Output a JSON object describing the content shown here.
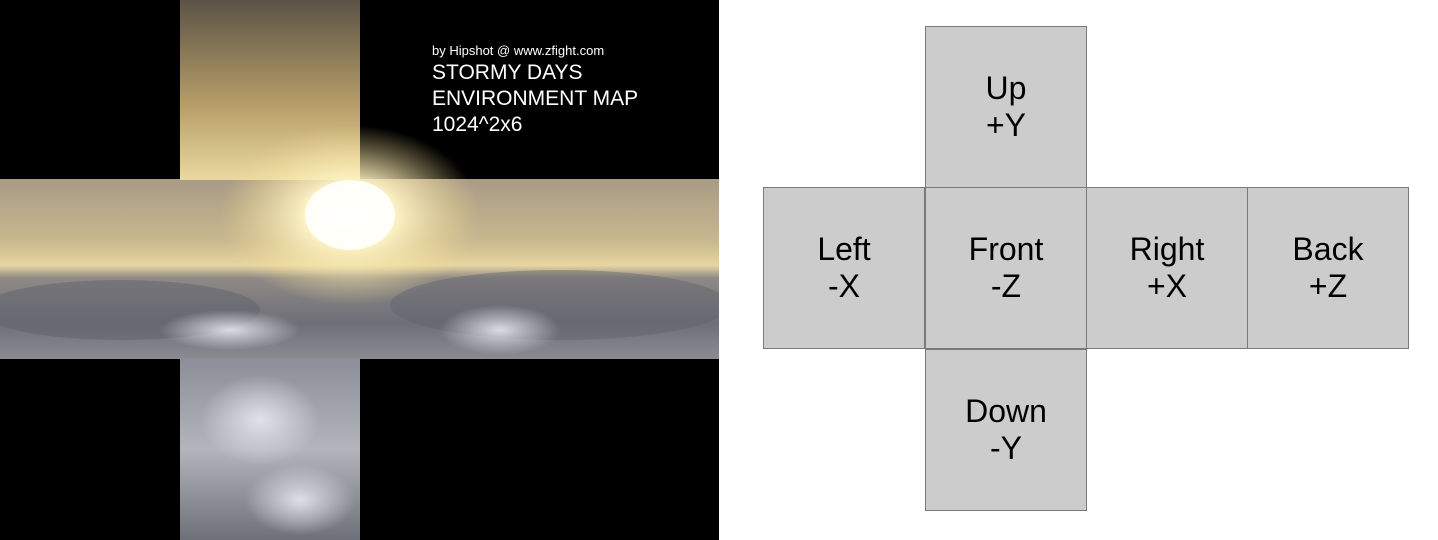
{
  "photo": {
    "credit": "by Hipshot @ www.zfight.com",
    "title_lines": [
      "STORMY DAYS",
      "ENVIRONMENT MAP",
      "1024^2x6"
    ]
  },
  "faces": [
    {
      "id": "up",
      "name": "Up",
      "axis": "+Y"
    },
    {
      "id": "left",
      "name": "Left",
      "axis": "-X"
    },
    {
      "id": "front",
      "name": "Front",
      "axis": "-Z"
    },
    {
      "id": "right",
      "name": "Right",
      "axis": "+X"
    },
    {
      "id": "back",
      "name": "Back",
      "axis": "+Z"
    },
    {
      "id": "down",
      "name": "Down",
      "axis": "-Y"
    }
  ],
  "colors": {
    "face_fill": "#cccccc",
    "face_border": "#7a7a7a",
    "background_black": "#000000",
    "caption_text": "#ffffff"
  }
}
